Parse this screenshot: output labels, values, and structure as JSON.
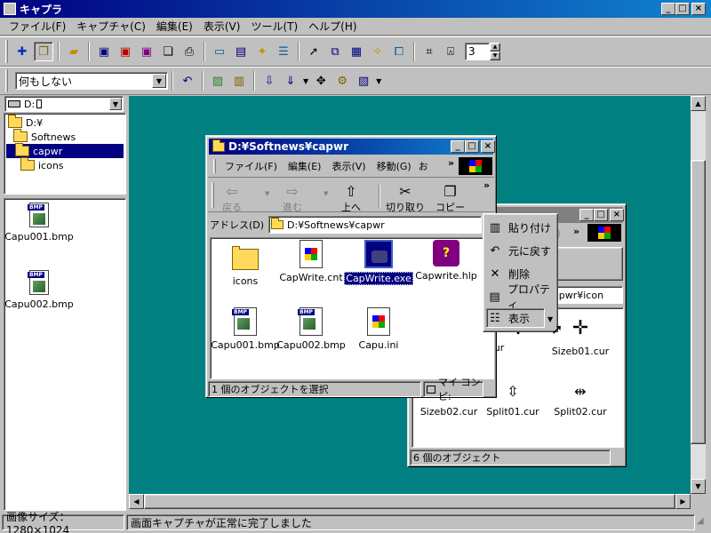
{
  "app": {
    "title": "キャプラ",
    "menu": [
      "ファイル(F)",
      "キャプチャ(C)",
      "編集(E)",
      "表示(V)",
      "ツール(T)",
      "ヘルプ(H)"
    ],
    "spin_value": "3",
    "action_combo": "何もしない"
  },
  "left": {
    "drive": "D: ",
    "tree": [
      "D:¥",
      "Softnews",
      "capwr",
      "icons"
    ],
    "thumbs": [
      "Capu001.bmp",
      "Capu002.bmp"
    ]
  },
  "explorer1": {
    "title": "D:¥Softnews¥capwr",
    "menu": [
      "ファイル(F)",
      "編集(E)",
      "表示(V)",
      "移動(G)",
      "お"
    ],
    "buttons": {
      "back": "戻る",
      "forward": "進む",
      "up": "上へ",
      "cut": "切り取り",
      "copy": "コピー"
    },
    "address_label": "アドレス(D)",
    "address": "D:¥Softnews¥capwr",
    "files": [
      "icons",
      "CapWrite.cnt",
      "CapWrite.exe",
      "Capwrite.hlp",
      "Capu001.bmp",
      "Capu002.bmp",
      "Capu.ini"
    ],
    "status": "1 個のオブジェクトを選択",
    "status_right": "マイ コンピ:"
  },
  "explorer2": {
    "address_tail": "apwr¥icon",
    "menu_tail": "V)",
    "files": [
      "ss02.cur",
      "Sizeb01.cur",
      "Sizeb02.cur",
      "Split01.cur",
      "Split02.cur"
    ],
    "status": "6 個のオブジェクト"
  },
  "popup": {
    "items": [
      "貼り付け",
      "元に戻す",
      "削除",
      "プロパティ",
      "表示"
    ]
  },
  "status": {
    "size": "画像サイズ：1280×1024",
    "message": "画面キャプチャが正常に完了しました"
  },
  "colors": {
    "title_active": "#000080",
    "desktop": "#008080",
    "selection": "#000080"
  }
}
